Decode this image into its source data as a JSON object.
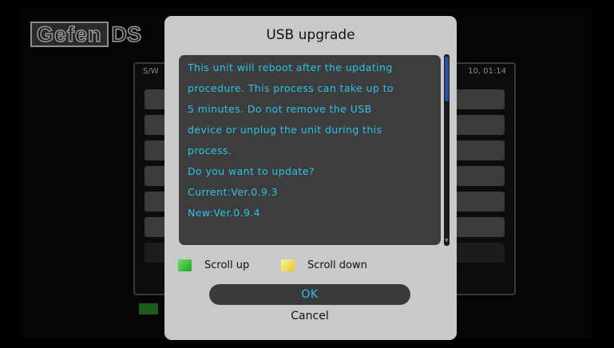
{
  "background": {
    "logo_text": "Gefen",
    "logo_suffix": "DS",
    "header_left": "S/W",
    "header_right": "10, 01:14"
  },
  "dialog": {
    "title": "USB upgrade",
    "message_lines": [
      "This unit will reboot after the updating",
      "procedure. This process can take up to",
      "5 minutes. Do not remove the USB",
      "device or unplug the unit during this",
      "process.",
      "Do you want to update?",
      "Current:Ver.0.9.3",
      "New:Ver.0.9.4"
    ],
    "scroll_up_label": "Scroll up",
    "scroll_down_label": "Scroll down",
    "ok_label": "OK",
    "cancel_label": "Cancel"
  },
  "colors": {
    "message_text": "#2ec2e6",
    "scroll_up_key": "#3cc43c",
    "scroll_down_key": "#f0dc50"
  }
}
